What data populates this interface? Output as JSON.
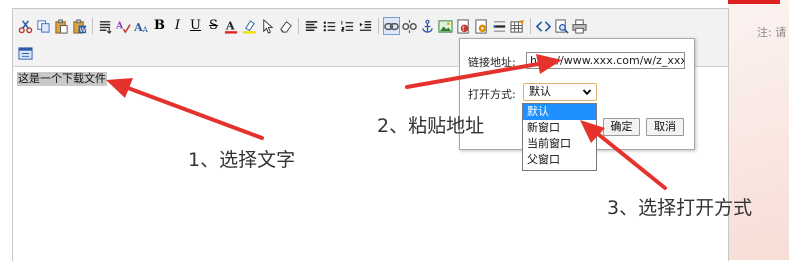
{
  "toolbar": {
    "row1": [
      {
        "name": "cut-icon"
      },
      {
        "name": "copy-icon"
      },
      {
        "name": "paste-icon"
      },
      {
        "name": "paste-word-icon"
      },
      {
        "sep": true
      },
      {
        "name": "format-block-icon"
      },
      {
        "name": "spellcheck-icon"
      },
      {
        "name": "font-size-icon"
      },
      {
        "name": "bold-icon",
        "glyph": "B"
      },
      {
        "name": "italic-icon",
        "glyph": "I"
      },
      {
        "name": "underline-icon",
        "glyph": "U"
      },
      {
        "name": "strikethrough-icon",
        "glyph": "S"
      },
      {
        "name": "font-color-icon"
      },
      {
        "name": "highlight-icon"
      },
      {
        "name": "select-pointer-icon"
      },
      {
        "name": "eraser-icon"
      },
      {
        "sep": true
      },
      {
        "name": "align-icon"
      },
      {
        "name": "unordered-list-icon"
      },
      {
        "name": "ordered-list-icon"
      },
      {
        "name": "indent-icon"
      },
      {
        "sep": true
      },
      {
        "name": "link-icon",
        "active": true
      },
      {
        "name": "unlink-icon"
      },
      {
        "name": "anchor-icon"
      },
      {
        "name": "image-icon"
      },
      {
        "name": "flash-icon"
      },
      {
        "name": "media-icon"
      },
      {
        "name": "horizontal-rule-icon"
      },
      {
        "name": "table-icon"
      },
      {
        "sep": true
      },
      {
        "name": "source-code-icon"
      },
      {
        "name": "preview-icon"
      },
      {
        "name": "print-icon"
      }
    ],
    "row2": [
      {
        "name": "fullscreen-icon"
      }
    ]
  },
  "editor": {
    "content": "这是一个下载文件"
  },
  "link_dialog": {
    "url_label": "链接地址:",
    "url_value": "http://www.xxx.com/w/z_xxx",
    "target_label": "打开方式:",
    "target_selected": "默认",
    "confirm_label": "确定",
    "cancel_label": "取消"
  },
  "target_dropdown": {
    "options": [
      "默认",
      "新窗口",
      "当前窗口",
      "父窗口"
    ],
    "selected_index": 0
  },
  "annotations": {
    "step1": "1、选择文字",
    "step2": "2、粘贴地址",
    "step3": "3、选择打开方式"
  },
  "side_note": "注: 请",
  "colors": {
    "arrow": "#e5322d",
    "dropdown_highlight": "#1e90ff",
    "page_accent": "#e02020"
  }
}
